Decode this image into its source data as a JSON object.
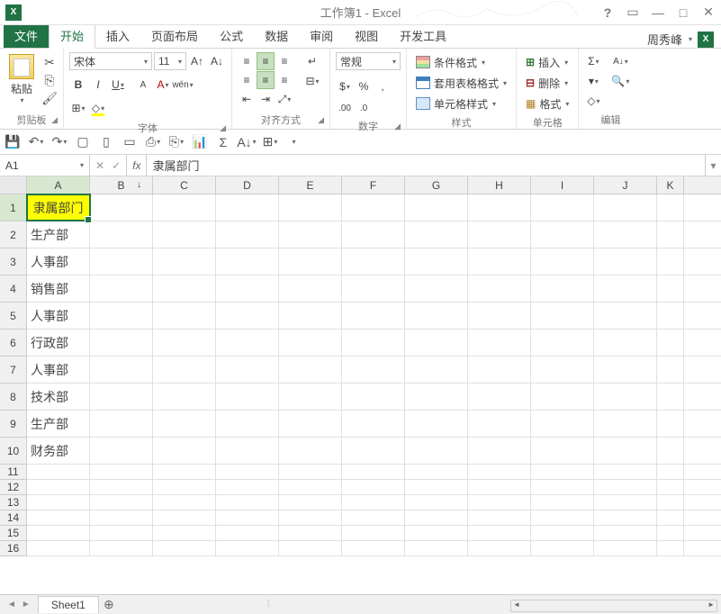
{
  "titlebar": {
    "title": "工作簿1 - Excel"
  },
  "tabs": {
    "file": "文件",
    "list": [
      "开始",
      "插入",
      "页面布局",
      "公式",
      "数据",
      "审阅",
      "视图",
      "开发工具"
    ],
    "active": 0,
    "user": "周秀峰"
  },
  "ribbon": {
    "clipboard": {
      "paste": "粘贴",
      "label": "剪贴板"
    },
    "font": {
      "name": "宋体",
      "size": "11",
      "label": "字体"
    },
    "alignment": {
      "label": "对齐方式"
    },
    "number": {
      "format": "常规",
      "label": "数字"
    },
    "styles": {
      "cond_format": "条件格式",
      "table_format": "套用表格格式",
      "cell_styles": "单元格样式",
      "label": "样式"
    },
    "cells": {
      "insert": "插入",
      "delete": "删除",
      "format": "格式",
      "label": "单元格"
    },
    "editing": {
      "label": "编辑"
    }
  },
  "namebox": "A1",
  "formula": "隶属部门",
  "columns": [
    "A",
    "B",
    "C",
    "D",
    "E",
    "F",
    "G",
    "H",
    "I",
    "J",
    "K"
  ],
  "rows_tall": [
    1,
    2,
    3,
    4,
    5,
    6,
    7,
    8,
    9,
    10
  ],
  "rows_short": [
    11,
    12,
    13,
    14,
    15,
    16
  ],
  "data": {
    "A1": "隶属部门",
    "A2": "生产部",
    "A3": "人事部",
    "A4": "销售部",
    "A5": "人事部",
    "A6": "行政部",
    "A7": "人事部",
    "A8": "技术部",
    "A9": "生产部",
    "A10": "财务部"
  },
  "sheet": {
    "name": "Sheet1"
  }
}
